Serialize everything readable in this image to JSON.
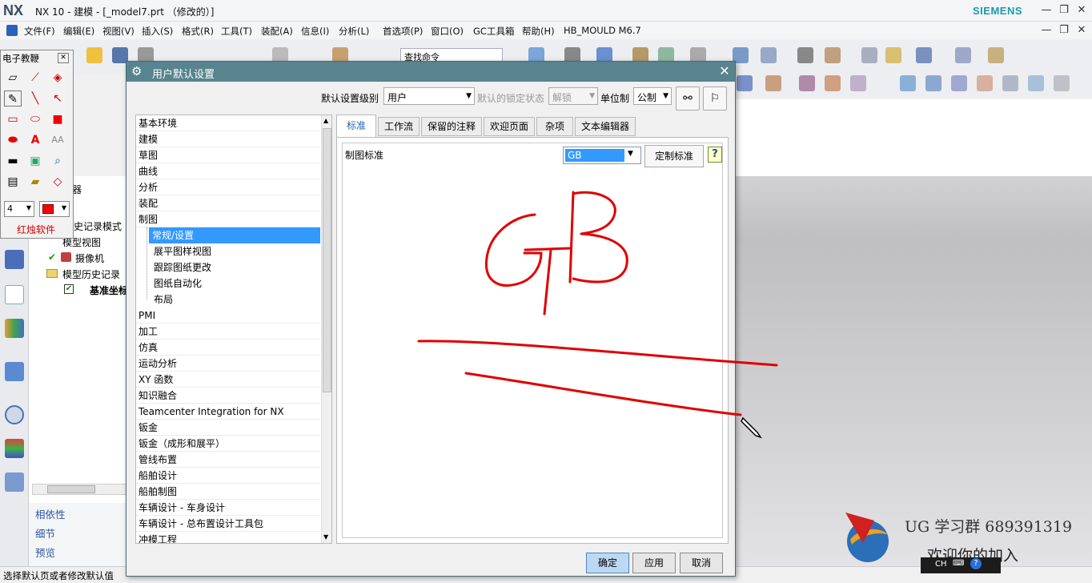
{
  "window": {
    "logo": "NX",
    "title": "NX 10 - 建模 - [_model7.prt （修改的）]",
    "brand": "SIEMENS"
  },
  "menubar": [
    "文件(F)",
    "编辑(E)",
    "视图(V)",
    "插入(S)",
    "格式(R)",
    "工具(T)",
    "装配(A)",
    "信息(I)",
    "分析(L)",
    "首选项(P)",
    "窗口(O)",
    "GC工具箱",
    "帮助(H)",
    "HB_MOULD M6.7"
  ],
  "toolbar": {
    "search_placeholder": "查找命令"
  },
  "electronic_whiteboard": {
    "title": "电子教鞭",
    "line_width": "4",
    "brand": "红烛软件",
    "tools": [
      "eraser-icon",
      "pipette-icon",
      "paint-bucket-icon",
      "pencil-icon",
      "line-icon",
      "arrow-icon",
      "rectangle-icon",
      "ellipse-icon",
      "filled-rectangle-icon",
      "filled-ellipse-icon",
      "text-icon",
      "font-size-icon",
      "thick-line-icon",
      "screen-icon",
      "zoom-icon",
      "save-icon",
      "open-icon",
      "shape-icon"
    ],
    "pen_color": "#ff0000"
  },
  "navigator": {
    "title_fragment": "器",
    "rows": [
      "史记录模式",
      "模型视图",
      "摄像机",
      "模型历史记录",
      "基准坐标"
    ],
    "panels": [
      "相依性",
      "细节",
      "预览"
    ]
  },
  "dialog": {
    "title": "用户默认设置",
    "level_label": "默认设置级别",
    "level_value": "用户",
    "lock_label": "默认的锁定状态",
    "lock_value": "解锁",
    "unit_label": "单位制",
    "unit_value": "公制",
    "categories": [
      "基本环境",
      "建模",
      "草图",
      "曲线",
      "分析",
      "装配",
      "制图"
    ],
    "sub_categories": [
      "常规/设置",
      "展平图样视图",
      "跟踪图纸更改",
      "图纸自动化",
      "布局"
    ],
    "selected_sub": "常规/设置",
    "categories_after": [
      "PMI",
      "加工",
      "仿真",
      "运动分析",
      "XY 函数",
      "知识融合",
      "Teamcenter Integration for NX",
      "钣金",
      "钣金（成形和展平）",
      "管线布置",
      "船舶设计",
      "船舶制图",
      "车辆设计 - 车身设计",
      "车辆设计 - 总布置设计工具包",
      "冲模工程"
    ],
    "tabs": [
      "标准",
      "工作流",
      "保留的注释",
      "欢迎页面",
      "杂项",
      "文本编辑器"
    ],
    "active_tab": "标准",
    "standard_label": "制图标准",
    "standard_value": "GB",
    "custom_button": "定制标准",
    "help": "?",
    "ok": "确定",
    "apply": "应用",
    "cancel": "取消"
  },
  "annotation": {
    "handwritten_text": "GB",
    "color": "#e00000"
  },
  "status_bar": {
    "text": "选择默认页或者修改默认值"
  },
  "watermark": {
    "line1": "UG 学习群 689391319",
    "line2": "欢迎你的加入"
  },
  "tray": {
    "ime": "CH"
  }
}
